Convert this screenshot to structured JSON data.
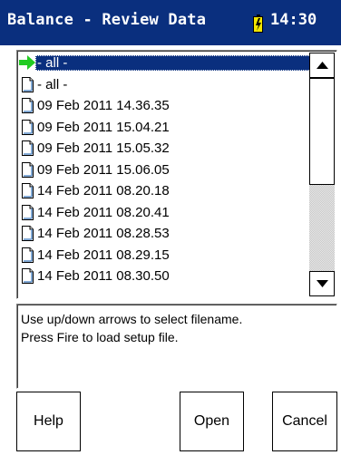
{
  "titlebar": {
    "title": "Balance - Review Data",
    "clock": "14:30"
  },
  "file_list": {
    "items": [
      {
        "label": "- all -",
        "icon": "arrow-icon",
        "selected": true
      },
      {
        "label": "- all -",
        "icon": "document-icon",
        "selected": false
      },
      {
        "label": "09 Feb 2011 14.36.35",
        "icon": "document-icon",
        "selected": false
      },
      {
        "label": "09 Feb 2011 15.04.21",
        "icon": "document-icon",
        "selected": false
      },
      {
        "label": "09 Feb 2011 15.05.32",
        "icon": "document-icon",
        "selected": false
      },
      {
        "label": "09 Feb 2011 15.06.05",
        "icon": "document-icon",
        "selected": false
      },
      {
        "label": "14 Feb 2011 08.20.18",
        "icon": "document-icon",
        "selected": false
      },
      {
        "label": "14 Feb 2011 08.20.41",
        "icon": "document-icon",
        "selected": false
      },
      {
        "label": "14 Feb 2011 08.28.53",
        "icon": "document-icon",
        "selected": false
      },
      {
        "label": "14 Feb 2011 08.29.15",
        "icon": "document-icon",
        "selected": false
      },
      {
        "label": "14 Feb 2011 08.30.50",
        "icon": "document-icon",
        "selected": false
      }
    ]
  },
  "help_text": {
    "line1": "Use up/down arrows to select filename.",
    "line2": "Press Fire to load setup file."
  },
  "buttons": {
    "help": "Help",
    "open": "Open",
    "cancel": "Cancel"
  },
  "colors": {
    "titlebar_bg": "#0a2f7e",
    "selection_bg": "#0a2f7e",
    "battery": "#f2e600",
    "arrow": "#22cc22"
  }
}
